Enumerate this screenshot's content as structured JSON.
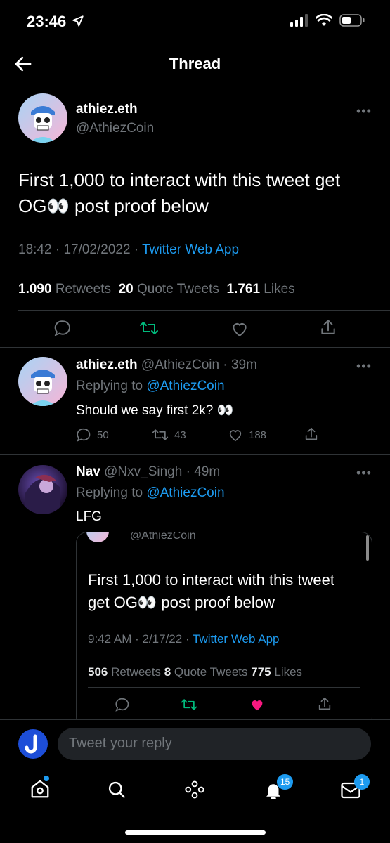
{
  "status_bar": {
    "time": "23:46"
  },
  "header": {
    "title": "Thread"
  },
  "main_tweet": {
    "name": "athiez.eth",
    "handle": "@AthiezCoin",
    "text": "First 1,000 to interact with this tweet get OG👀 post proof below",
    "time": "18:42",
    "date": "17/02/2022",
    "source": "Twitter Web App",
    "retweets": "1.090",
    "retweets_label": "Retweets",
    "quotes": "20",
    "quotes_label": "Quote Tweets",
    "likes": "1.761",
    "likes_label": "Likes"
  },
  "reply1": {
    "name": "athiez.eth",
    "handle": "@AthiezCoin",
    "age": "39m",
    "replying_label": "Replying to",
    "replying_to": "@AthiezCoin",
    "text": "Should we say first 2k? 👀",
    "replies": "50",
    "retweets": "43",
    "likes": "188"
  },
  "reply2": {
    "name": "Nav",
    "handle": "@Nxv_Singh",
    "age": "49m",
    "replying_label": "Replying to",
    "replying_to": "@AthiezCoin",
    "text": "LFG",
    "quoted": {
      "handle": "@AthiezCoin",
      "text": "First 1,000 to interact with this tweet get OG👀 post proof below",
      "time": "9:42 AM",
      "date": "2/17/22",
      "source": "Twitter Web App",
      "retweets": "506",
      "retweets_label": "Retweets",
      "quotes": "8",
      "quotes_label": "Quote Tweets",
      "likes": "775",
      "likes_label": "Likes"
    }
  },
  "compose": {
    "placeholder": "Tweet your reply"
  },
  "tabbar": {
    "notifications_badge": "15",
    "messages_badge": "1"
  },
  "colors": {
    "accent": "#1d9bf0",
    "retweet_green": "#00ba7c",
    "like_pink": "#f91880",
    "muted": "#71767b"
  }
}
